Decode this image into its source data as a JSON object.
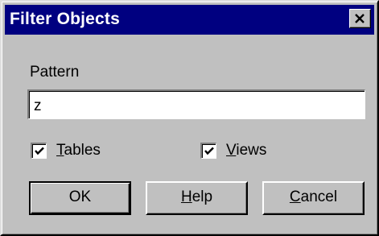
{
  "window": {
    "title": "Filter Objects",
    "close_label": "Close"
  },
  "pattern": {
    "label": "Pattern",
    "value": "z"
  },
  "options": {
    "tables": {
      "mnemonic": "T",
      "rest": "ables",
      "checked": true
    },
    "views": {
      "mnemonic": "V",
      "rest": "iews",
      "checked": true
    }
  },
  "buttons": {
    "ok": {
      "label": "OK"
    },
    "help": {
      "mnemonic": "H",
      "rest": "elp"
    },
    "cancel": {
      "mnemonic": "C",
      "rest": "ancel"
    }
  },
  "colors": {
    "titlebar": "#000080",
    "face": "#c0c0c0",
    "field": "#ffffff"
  },
  "icons": [
    "close-icon",
    "checkmark-icon"
  ]
}
